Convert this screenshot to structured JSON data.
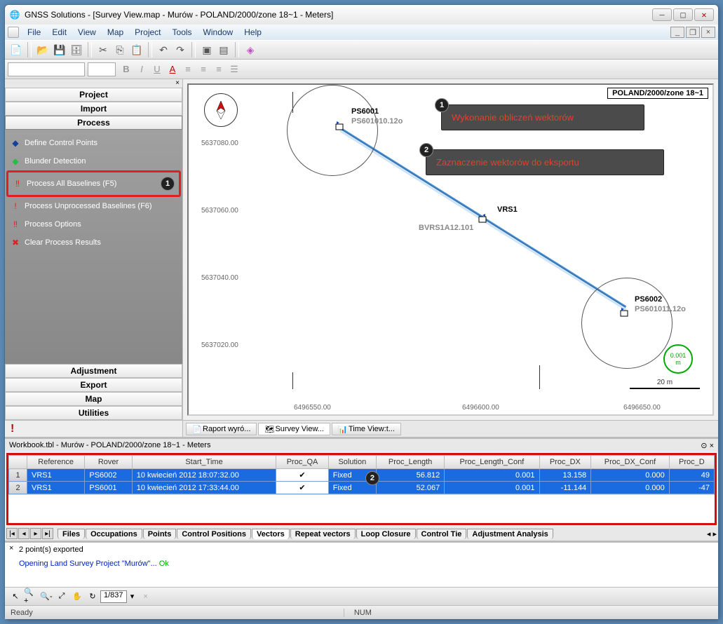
{
  "title": "GNSS Solutions - [Survey View.map - Murów - POLAND/2000/zone 18~1 - Meters]",
  "menu": {
    "file": "File",
    "edit": "Edit",
    "view": "View",
    "map": "Map",
    "project": "Project",
    "tools": "Tools",
    "window": "Window",
    "help": "Help"
  },
  "sidebar": {
    "headers": [
      "Project",
      "Import",
      "Process",
      "Adjustment",
      "Export",
      "Map",
      "Utilities"
    ],
    "items": [
      {
        "label": "Define Control Points",
        "icon": "◆",
        "color": "#1040a0"
      },
      {
        "label": "Blunder Detection",
        "icon": "◆",
        "color": "#20c040"
      },
      {
        "label": "Process All Baselines (F5)",
        "icon": "‼",
        "color": "#e02020",
        "hl": true,
        "badge": "1"
      },
      {
        "label": "Process Unprocessed Baselines (F6)",
        "icon": "!",
        "color": "#e02020"
      },
      {
        "label": "Process Options",
        "icon": "‼",
        "color": "#e02020"
      },
      {
        "label": "Clear Process Results",
        "icon": "✖",
        "color": "#e02020"
      }
    ]
  },
  "map": {
    "title_box": "POLAND/2000/zone 18~1",
    "yticks": [
      "5637080.00",
      "5637060.00",
      "5637040.00",
      "5637020.00"
    ],
    "xticks": [
      "6496550.00",
      "6496600.00",
      "6496650.00"
    ],
    "points": {
      "p1": {
        "name": "PS6001",
        "file": "PS601010.12o"
      },
      "vrs": {
        "name": "VRS1",
        "file": "BVRS1A12.101"
      },
      "p2": {
        "name": "PS6002",
        "file": "PS601011.12o"
      }
    },
    "scale": "20 m",
    "green": {
      "v": "0.001",
      "u": "m"
    },
    "callouts": {
      "c1": "Wykonanie obliczeń wektorów",
      "c2": "Zaznaczenie wektorów do eksportu"
    },
    "tabs": [
      "Raport wyró...",
      "Survey View...",
      "Time View:t..."
    ]
  },
  "workbook": {
    "title": "Workbook.tbl - Murów - POLAND/2000/zone 18~1 - Meters",
    "cols": [
      "Reference",
      "Rover",
      "Start_Time",
      "Proc_QA",
      "Solution",
      "Proc_Length",
      "Proc_Length_Conf",
      "Proc_DX",
      "Proc_DX_Conf",
      "Proc_D"
    ],
    "rows": [
      {
        "n": "1",
        "ref": "VRS1",
        "rov": "PS6002",
        "st": "10 kwiecień 2012 18:07:32.00",
        "qa": "✔",
        "sol": "Fixed",
        "len": "56.812",
        "lc": "0.001",
        "dx": "13.158",
        "dxc": "0.000",
        "pd": "49"
      },
      {
        "n": "2",
        "ref": "VRS1",
        "rov": "PS6001",
        "st": "10 kwiecień 2012 17:33:44.00",
        "qa": "✔",
        "sol": "Fixed",
        "len": "52.067",
        "lc": "0.001",
        "dx": "-11.144",
        "dxc": "0.000",
        "pd": "-47"
      }
    ],
    "badge": "2",
    "tabs": [
      "Files",
      "Occupations",
      "Points",
      "Control Positions",
      "Vectors",
      "Repeat vectors",
      "Loop Closure",
      "Control Tie",
      "Adjustment Analysis"
    ]
  },
  "console": {
    "l1": "2 point(s) exported",
    "l2a": "Opening Land Survey Project \"Murów\"... ",
    "l2b": "Ok"
  },
  "bottom": {
    "zoom": "1/837"
  },
  "status": {
    "ready": "Ready",
    "num": "NUM"
  }
}
